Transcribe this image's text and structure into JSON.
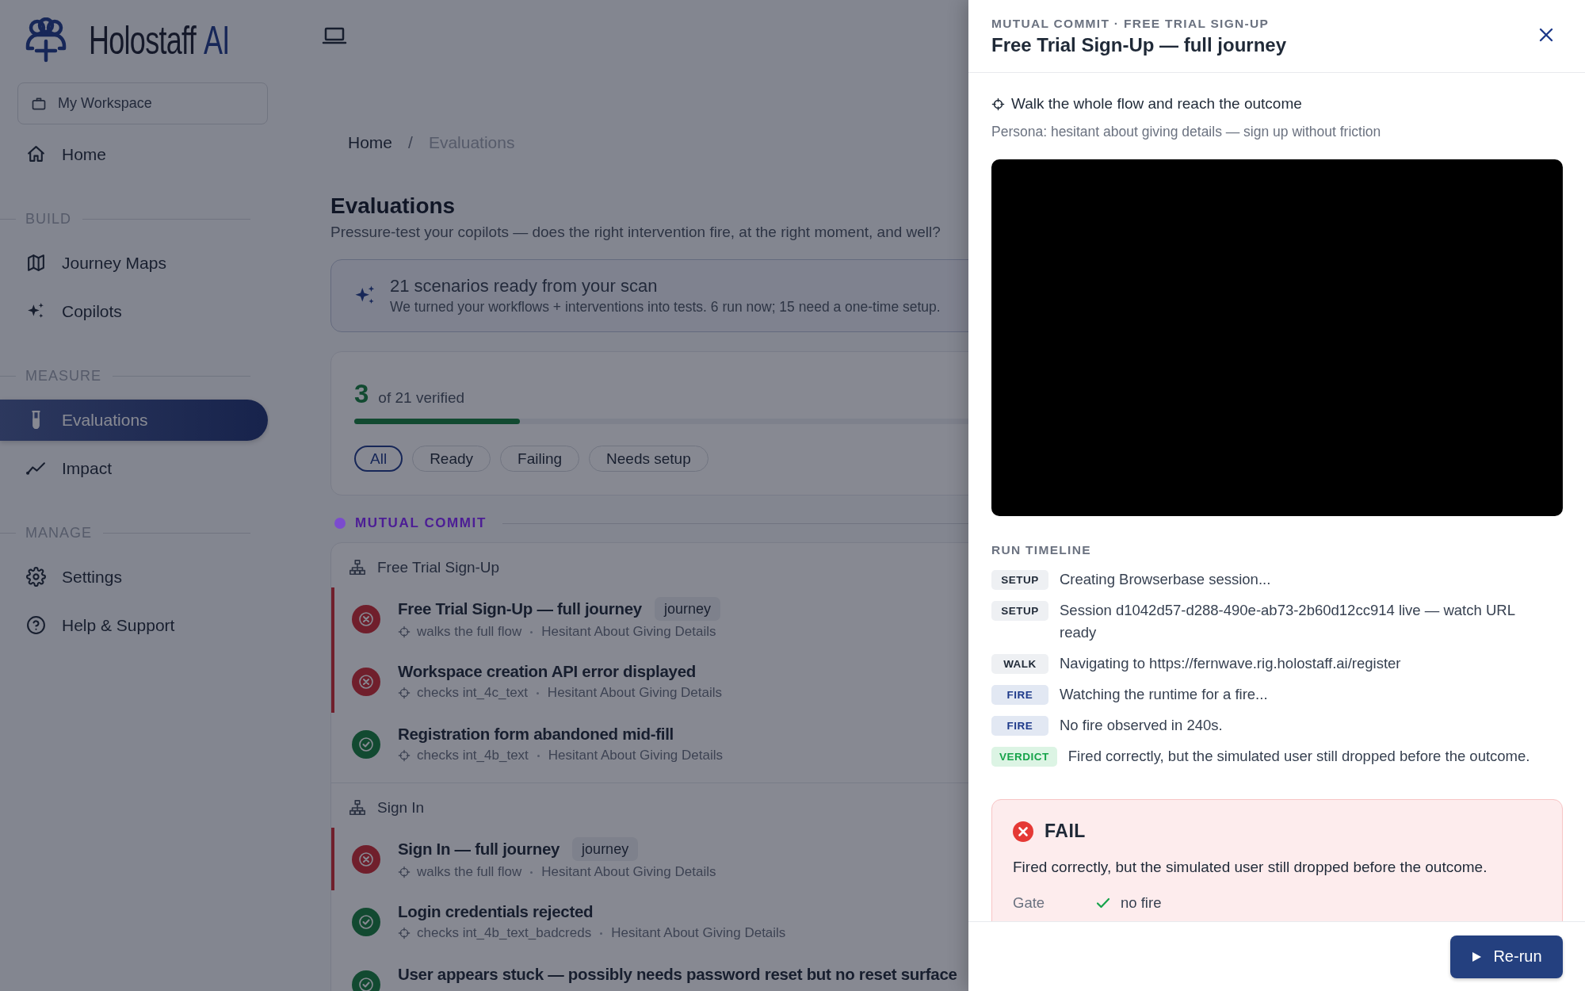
{
  "app": {
    "brand": "Holostaff",
    "brand_suffix": "AI"
  },
  "sidebar": {
    "workspace": "My Workspace",
    "items": [
      {
        "kind": "item",
        "label": "Home",
        "selected": false
      },
      {
        "kind": "section",
        "label": "BUILD"
      },
      {
        "kind": "item",
        "label": "Journey Maps",
        "selected": false
      },
      {
        "kind": "item",
        "label": "Copilots",
        "selected": false
      },
      {
        "kind": "section",
        "label": "MEASURE"
      },
      {
        "kind": "item",
        "label": "Evaluations",
        "selected": true
      },
      {
        "kind": "item",
        "label": "Impact",
        "selected": false
      },
      {
        "kind": "section",
        "label": "MANAGE"
      },
      {
        "kind": "item",
        "label": "Settings",
        "selected": false
      },
      {
        "kind": "item",
        "label": "Help & Support",
        "selected": false
      }
    ]
  },
  "breadcrumb": {
    "separator": "/",
    "items": [
      {
        "label": "Home",
        "current": false
      },
      {
        "label": "Evaluations",
        "current": true
      }
    ]
  },
  "page": {
    "title": "Evaluations",
    "subtitle": "Pressure-test your copilots — does the right intervention fire, at the right moment, and well?"
  },
  "banner": {
    "title": "21 scenarios ready from your scan",
    "text": "We turned your workflows + interventions into tests. 6 run now; 15 need a one-time setup."
  },
  "progress": {
    "count": "3",
    "label": "of 21 verified",
    "level": 0.143
  },
  "filters": [
    {
      "label": "All",
      "selected": true
    },
    {
      "label": "Ready",
      "selected": false
    },
    {
      "label": "Failing",
      "selected": false
    },
    {
      "label": "Needs setup",
      "selected": false
    }
  ],
  "groups": [
    {
      "label": "MUTUAL COMMIT",
      "color": "#7b4bce",
      "flows": [
        {
          "name": "Free Trial Sign-Up",
          "scenarios": [
            {
              "title": "Free Trial Sign-Up — full journey",
              "tag": "journey",
              "kind": "fail",
              "check": "walks the full flow",
              "persona": "Hesitant About Giving Details"
            },
            {
              "title": "Workspace creation API error displayed",
              "kind": "fail",
              "check": "checks int_4c_text",
              "persona": "Hesitant About Giving Details"
            },
            {
              "title": "Registration form abandoned mid-fill",
              "kind": "pass",
              "check": "checks int_4b_text",
              "persona": "Hesitant About Giving Details"
            }
          ]
        },
        {
          "name": "Sign In",
          "scenarios": [
            {
              "title": "Sign In — full journey",
              "tag": "journey",
              "kind": "fail",
              "check": "walks the full flow",
              "persona": "Hesitant About Giving Details"
            },
            {
              "title": "Login credentials rejected",
              "kind": "pass",
              "check": "checks int_4b_text_badcreds",
              "persona": "Hesitant About Giving Details"
            },
            {
              "title": "User appears stuck — possibly needs password reset but no reset surface",
              "kind": "pass"
            }
          ]
        }
      ]
    }
  ],
  "drawer": {
    "eyebrow": "MUTUAL COMMIT · FREE TRIAL SIGN-UP",
    "title": "Free Trial Sign-Up — full journey",
    "goal": "Walk the whole flow and reach the outcome",
    "persona": "Persona: hesitant about giving details — sign up without friction",
    "timeline_label": "RUN TIMELINE",
    "timeline": [
      {
        "kind": "setup",
        "tag": "SETUP",
        "text": "Creating Browserbase session..."
      },
      {
        "kind": "setup",
        "tag": "SETUP",
        "text": "Session d1042d57-d288-490e-ab73-2b60d12cc914 live — watch URL ready"
      },
      {
        "kind": "walk",
        "tag": "WALK",
        "text": "Navigating to https://fernwave.rig.holostaff.ai/register"
      },
      {
        "kind": "fire",
        "tag": "FIRE",
        "text": "Watching the runtime for a fire..."
      },
      {
        "kind": "fire",
        "tag": "FIRE",
        "text": "No fire observed in 240s."
      },
      {
        "kind": "verdict",
        "tag": "VERDICT",
        "text": "Fired correctly, but the simulated user still dropped before the outcome."
      }
    ],
    "result": {
      "kind": "fail",
      "label": "FAIL",
      "summary": "Fired correctly, but the simulated user still dropped before the outcome.",
      "rows": [
        {
          "label": "Gate",
          "passed": true,
          "value": "no fire"
        }
      ]
    },
    "action": "Re-run"
  }
}
